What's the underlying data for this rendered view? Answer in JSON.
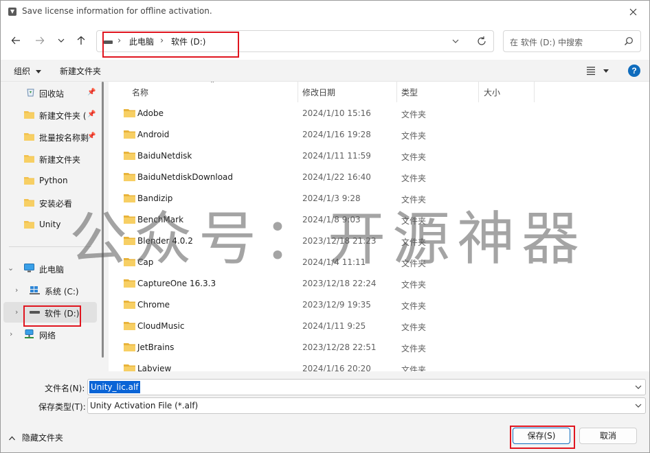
{
  "window": {
    "title": "Save license information for offline activation."
  },
  "address_bar": {
    "crumbs": [
      "此电脑",
      "软件 (D:)"
    ],
    "search_placeholder": "在 软件 (D:) 中搜索"
  },
  "command_bar": {
    "organize": "组织",
    "new_folder": "新建文件夹",
    "help": "?"
  },
  "sidebar": {
    "quick_access": [
      {
        "label": "回收站",
        "icon": "recycle-bin-icon",
        "pinned": true
      },
      {
        "label": "新建文件夹 (",
        "icon": "folder-icon",
        "pinned": true
      },
      {
        "label": "批量按名称剩",
        "icon": "folder-icon",
        "pinned": true
      },
      {
        "label": "新建文件夹",
        "icon": "folder-icon",
        "pinned": false
      },
      {
        "label": "Python",
        "icon": "folder-icon",
        "pinned": false
      },
      {
        "label": "安装必看",
        "icon": "folder-icon",
        "pinned": false
      },
      {
        "label": "Unity",
        "icon": "folder-icon",
        "pinned": false
      }
    ],
    "tree": [
      {
        "label": "此电脑",
        "icon": "pc-icon",
        "expanded": true
      },
      {
        "label": "系统 (C:)",
        "icon": "windows-drive-icon"
      },
      {
        "label": "软件 (D:)",
        "icon": "drive-icon",
        "selected": true
      },
      {
        "label": "网络",
        "icon": "network-icon"
      }
    ]
  },
  "file_list": {
    "columns": [
      "名称",
      "修改日期",
      "类型",
      "大小"
    ],
    "rows": [
      {
        "name": "Adobe",
        "date": "2024/1/10 15:16",
        "type": "文件夹"
      },
      {
        "name": "Android",
        "date": "2024/1/16 19:28",
        "type": "文件夹"
      },
      {
        "name": "BaiduNetdisk",
        "date": "2024/1/11 11:59",
        "type": "文件夹"
      },
      {
        "name": "BaiduNetdiskDownload",
        "date": "2024/1/22 16:40",
        "type": "文件夹"
      },
      {
        "name": "Bandizip",
        "date": "2024/1/3 9:28",
        "type": "文件夹"
      },
      {
        "name": "BenchMark",
        "date": "2024/1/8 9:03",
        "type": "文件夹"
      },
      {
        "name": "Blender 4.0.2",
        "date": "2023/12/18 21:23",
        "type": "文件夹"
      },
      {
        "name": "Cap",
        "date": "2024/1/4 11:11",
        "type": "文件夹"
      },
      {
        "name": "CaptureOne 16.3.3",
        "date": "2023/12/18 22:24",
        "type": "文件夹"
      },
      {
        "name": "Chrome",
        "date": "2023/12/9 19:35",
        "type": "文件夹"
      },
      {
        "name": "CloudMusic",
        "date": "2024/1/11 9:25",
        "type": "文件夹"
      },
      {
        "name": "JetBrains",
        "date": "2023/12/28 22:51",
        "type": "文件夹"
      },
      {
        "name": "Labview",
        "date": "2024/1/16 20:20",
        "type": "文件夹"
      }
    ]
  },
  "save_fields": {
    "filename_label": "文件名(N):",
    "filename_value": "Unity_lic.alf",
    "filetype_label": "保存类型(T):",
    "filetype_value": "Unity Activation File (*.alf)"
  },
  "footer": {
    "hide_folders": "隐藏文件夹",
    "save_button": "保存(S)",
    "cancel_button": "取消"
  },
  "watermark": {
    "text": "公众号：开源神器"
  },
  "colors": {
    "highlight": "#e0141e",
    "accent": "#0f6cbd",
    "folder": "#f2c14e"
  }
}
